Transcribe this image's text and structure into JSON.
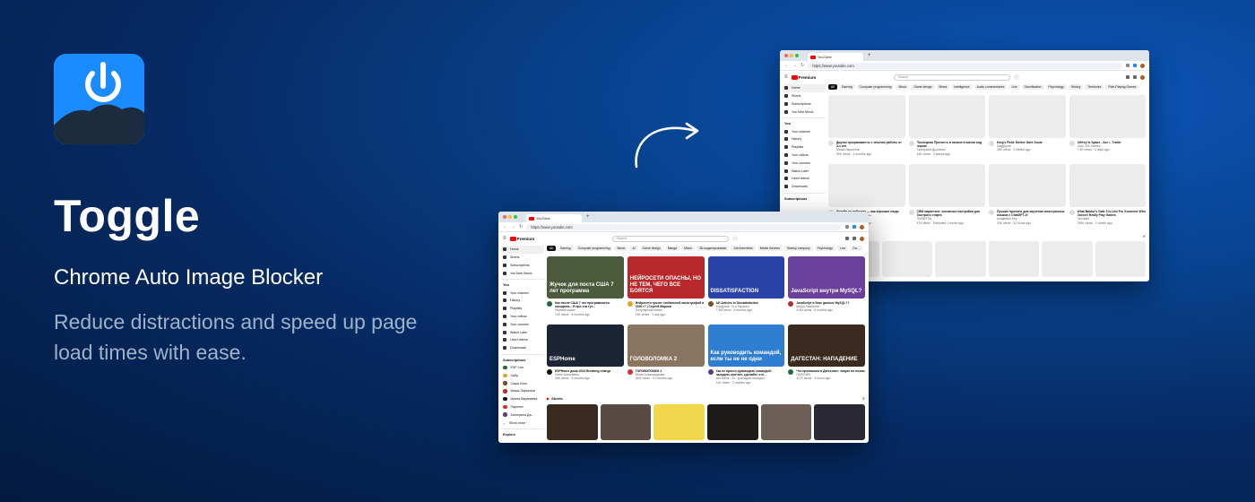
{
  "brand": {
    "title": "Toggle",
    "subtitle": "Chrome Auto Image Blocker",
    "description": "Reduce distractions and speed up page load times with ease.",
    "accent_color": "#1a8cff",
    "logo_icon": "power-mountain-icon"
  },
  "browser": {
    "tab_title": "YouTube",
    "url": "https://www.youtube.com",
    "youtube_label": "Premium",
    "search_placeholder": "Search"
  },
  "sidebar": {
    "main": [
      "Home",
      "Shorts",
      "Subscriptions",
      "YouTube Music"
    ],
    "you_heading": "You",
    "you": [
      "Your channel",
      "History",
      "Playlists",
      "Your videos",
      "Your courses",
      "Watch Later",
      "Liked videos",
      "Downloads"
    ],
    "subs_heading": "Subscriptions",
    "subs": [
      "ESP Live",
      "Хабр",
      "Саша Лоск",
      "Миша Ларионов",
      "Ирина Варапаева",
      "Паренек",
      "Екатерина Да..."
    ],
    "show_more": "Show more",
    "explore_heading": "Explore"
  },
  "chips_window1": [
    "All",
    "Gaming",
    "Computer programming",
    "Music",
    "Game design",
    "Mixes",
    "Intelligence",
    "Audio commentaries",
    "Live",
    "Gamification",
    "Psychology",
    "History",
    "Territories",
    "Role-Playing Games"
  ],
  "chips_window2": [
    "All",
    "Gaming",
    "Computer programming",
    "Music",
    "AI",
    "Game design",
    "Manga",
    "Mixes",
    "3D-моделирование",
    "Job interviews",
    "Media theories",
    "Startup company",
    "Psychology",
    "Live",
    "Ga..."
  ],
  "videos_window1": [
    {
      "title": "Джуны программисты с опытом работы от 3-х лет",
      "channel": "Миша Ларионов",
      "stats": "59K views · 2 months ago"
    },
    {
      "title": "Последняя Прелесть в начале в жизни под пирою",
      "channel": "Екатерина Дьяченко",
      "stats": "44K views · 3 weeks ago"
    },
    {
      "title": "King's Field: Before Dark Souls",
      "channel": "SaggSpire",
      "stats": "28K views · 3 weeks ago"
    },
    {
      "title": "Jeffrey Is Space - Act I - Trailer",
      "channel": "Guru 100 Games",
      "stats": "7.3K views · 3 days ago"
    },
    {
      "title": "Дизайн не работает — как хорошие люди делают плохие рубли...",
      "channel": "AnotherOne",
      "stats": "1.1M views · 3 weeks ago"
    },
    {
      "title": "CRM маркетинг: основные настройки для быстрого старта",
      "channel": "RUSMTSA",
      "stats": "479 views · Streamed 1 month ago"
    },
    {
      "title": "Лучшие проекты для изучения иностранных языков с ChatGPT-4!",
      "channel": "Академия Key",
      "stats": "33K views · 11 hours ago"
    },
    {
      "title": "What Baldur's Gate 3 Is Like For Someone Who Doesn't Really Play Games",
      "channel": "Gezhafur",
      "stats": "789K views · 1 month ago"
    }
  ],
  "videos_window2": [
    {
      "title": "Как после США 7 лет программисты находили... Я про эти тут...",
      "channel": "Первый канал",
      "stats": "14K views · 6 months ago",
      "thumb_text": "Жучок для поста США 7 лет программа",
      "thumb_bg": "#4a5a3a"
    },
    {
      "title": "Нейросети грозят глобальной катастрофой в 2030 г? | Сергей Марков",
      "channel": "Популярный канал",
      "stats": "14K views · 1 day ago",
      "thumb_text": "НЕЙРОСЕТИ ОПАСНЫ, НО НЕ ТЕМ, ЧЕГО ВСЕ БОЯТСЯ",
      "thumb_bg": "#b9282a"
    },
    {
      "title": "АИ Articles in Dissatisfaction",
      "channel": "Колдунов · is a Squared",
      "stats": "7.9M views · 6 months ago",
      "thumb_text": "DISSATISFACTION",
      "thumb_bg": "#2a43a8"
    },
    {
      "title": "JavaScript в базе данных MySQL??",
      "channel": "Миша Ларионов",
      "stats": "4.4M views · 8 months ago",
      "thumb_text": "JavaScript внутри MySQL?",
      "thumb_bg": "#6b3f9c"
    },
    {
      "title": "ESPHome дома 2024 Breaking change",
      "channel": "Home Automation",
      "stats": "46K views · 6 months ago",
      "thumb_text": "ESPHome",
      "thumb_bg": "#1c2533"
    },
    {
      "title": "ГОЛОВОЛОМКА 2",
      "channel": "Юлия Александрова",
      "stats": "34M views · 10 months ago",
      "thumb_text": "ГОЛОВОЛОМКА 2",
      "thumb_bg": "#8a7560"
    },
    {
      "title": "Как не просто руководить командой: наладить контакт, сделайте что...",
      "channel": "doc Меня · 2x · докладов на видео",
      "stats": "21K views · 2 months ago",
      "thumb_text": "Как руководить командой, если ты не не одни",
      "thumb_bg": "#2f7dd1"
    },
    {
      "title": "Что произошло в Дагестане: запуск по ночам",
      "channel": "ПАРЕНЕК",
      "stats": "117K views · 4 hours ago",
      "thumb_text": "ДАГЕСТАН: НАПАДЕНИЕ",
      "thumb_bg": "#3a2a20"
    }
  ],
  "shorts_heading": "Shorts",
  "shorts_colors": [
    "#3b2a1f",
    "#5a4a44",
    "#f2d64b",
    "#1e1a1a",
    "#6d5f55",
    "#2a2833"
  ]
}
